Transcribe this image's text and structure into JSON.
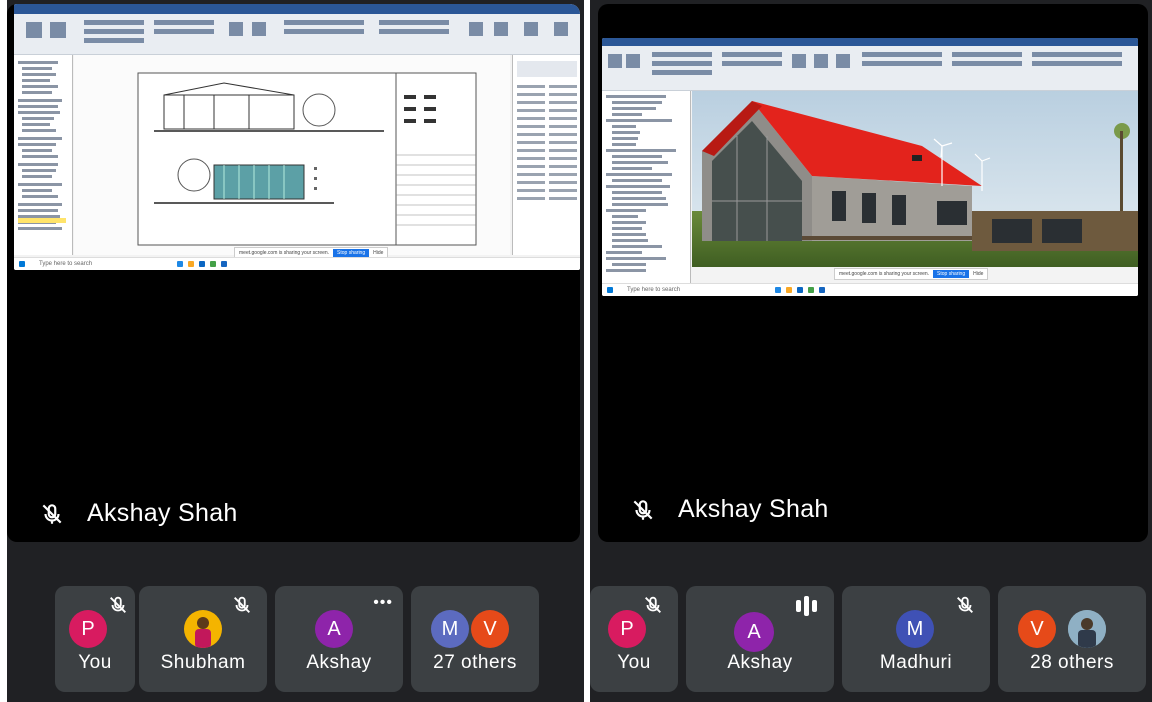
{
  "left_call": {
    "presenter": "Akshay Shah",
    "shared_screen": {
      "app": "Revit drawing sheet",
      "taskbar_search": "Type here to search",
      "share_notice": "meet.google.com is sharing your screen.",
      "stop_sharing": "Stop sharing",
      "hide": "Hide"
    },
    "participants": [
      {
        "label": "You",
        "initial": "P",
        "color": "#d81b60",
        "muted": true
      },
      {
        "label": "Shubham",
        "initial": "",
        "color": "#f4b400",
        "muted": true
      },
      {
        "label": "Akshay",
        "initial": "A",
        "color": "#8e24aa",
        "muted": false,
        "more_icon": true
      },
      {
        "label": "27 others",
        "initials": [
          "M",
          "V"
        ],
        "colors": [
          "#5c6bc0",
          "#e64a19"
        ]
      }
    ]
  },
  "right_call": {
    "presenter": "Akshay Shah",
    "shared_screen": {
      "app": "Revit 3D house view",
      "taskbar_search": "Type here to search",
      "share_notice": "meet.google.com is sharing your screen.",
      "stop_sharing": "Stop sharing",
      "hide": "Hide"
    },
    "participants": [
      {
        "label": "You",
        "initial": "P",
        "color": "#d81b60",
        "muted": true
      },
      {
        "label": "Akshay",
        "initial": "A",
        "color": "#8e24aa",
        "speaking": true
      },
      {
        "label": "Madhuri",
        "initial": "M",
        "color": "#3f51b5",
        "muted": true
      },
      {
        "label": "28 others",
        "initials": [
          "V",
          ""
        ],
        "colors": [
          "#e64a19",
          "#7fa3b5"
        ]
      }
    ]
  }
}
